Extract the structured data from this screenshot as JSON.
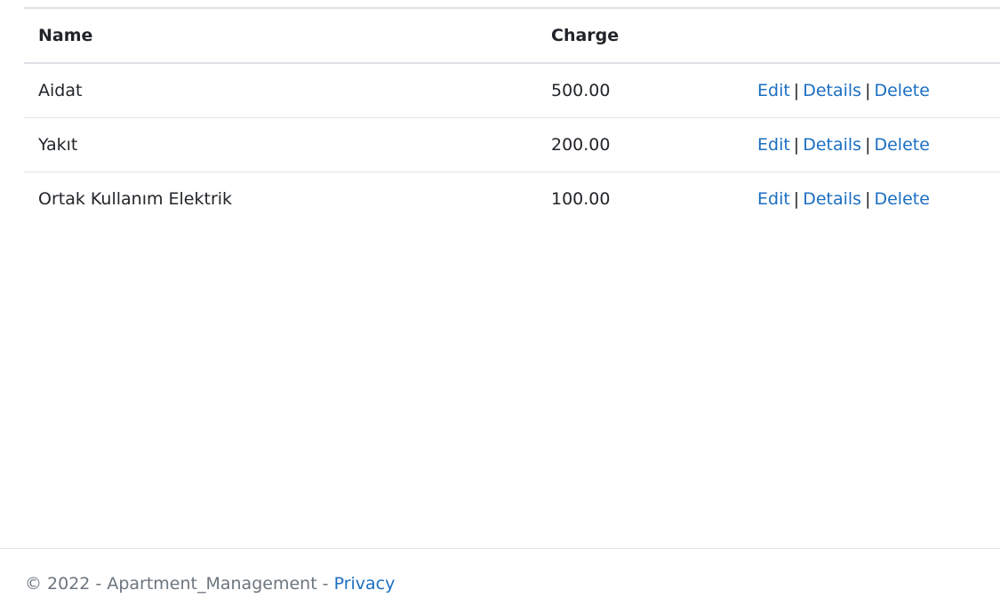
{
  "table": {
    "headers": {
      "name": "Name",
      "charge": "Charge",
      "actions": ""
    },
    "rows": [
      {
        "name": "Aidat",
        "charge": "500.00"
      },
      {
        "name": "Yakıt",
        "charge": "200.00"
      },
      {
        "name": "Ortak Kullanım Elektrik",
        "charge": "100.00"
      }
    ],
    "actions": {
      "edit": "Edit",
      "details": "Details",
      "delete": "Delete",
      "separator": "|"
    }
  },
  "footer": {
    "copyright": "© 2022 - Apartment_Management - ",
    "privacy_link": "Privacy"
  },
  "colors": {
    "link": "#1b6ec2",
    "text": "#212529",
    "muted": "#6c757d",
    "border": "#dee2e6"
  }
}
